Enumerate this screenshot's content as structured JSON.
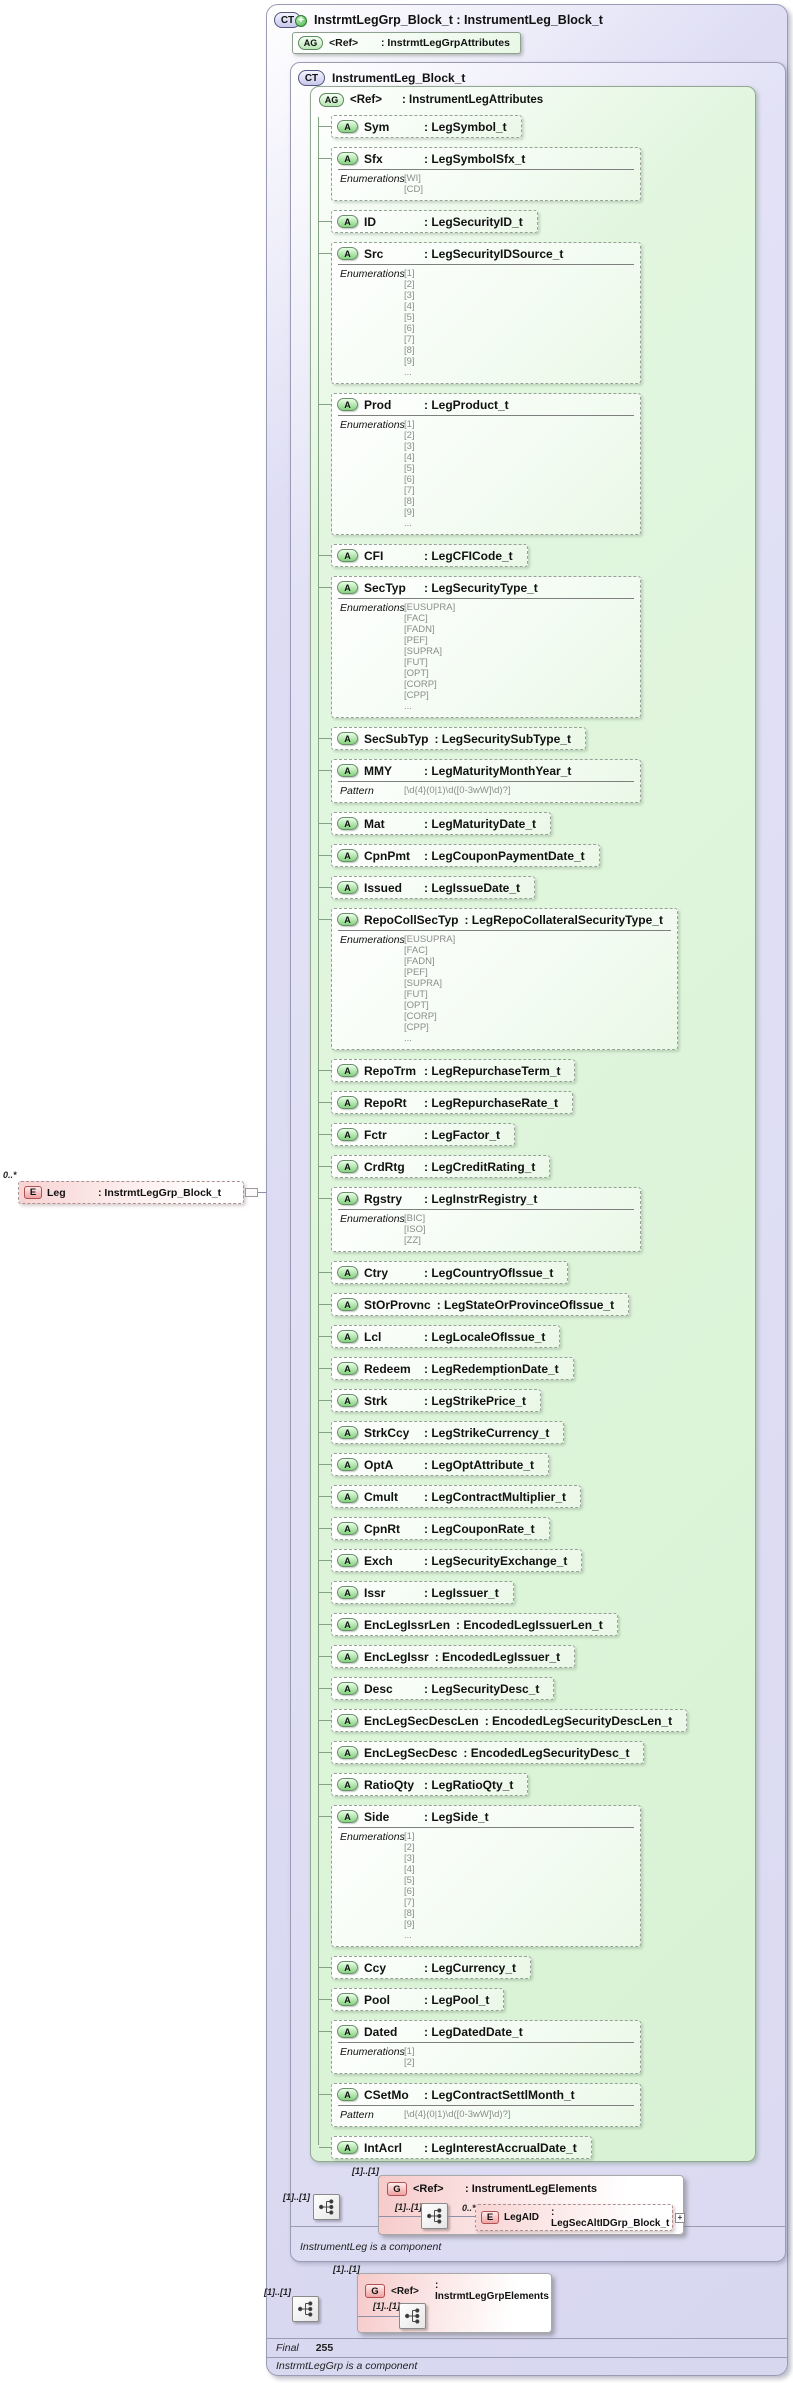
{
  "diagram": {
    "outer": {
      "badge": "CT",
      "badge_plus": "+",
      "title": "InstrmtLegGrp_Block_t : InstrumentLeg_Block_t",
      "final_label": "Final",
      "final_value": "255",
      "footnote": "InstrmtLegGrp is a component",
      "attr_ref": {
        "badge": "AG",
        "name": "<Ref>",
        "type": ": InstrmtLegGrpAttributes"
      },
      "elements_ref": {
        "badge": "G",
        "name": "<Ref>",
        "type": ": InstrmtLegGrpElements",
        "outer_cardinality": "[1]..[1]",
        "ref_cardinality": "[1]..[1]",
        "inner_cardinality": "[1]..[1]"
      }
    },
    "leg_element": {
      "cardinality": "0..*",
      "badge": "E",
      "name": "Leg",
      "type": ": InstrmtLegGrp_Block_t"
    },
    "inner": {
      "badge": "CT",
      "title": "InstrumentLeg_Block_t",
      "footnote": "InstrumentLeg is a component",
      "attr_group": {
        "badge": "AG",
        "name": "<Ref>",
        "type": ": InstrumentLegAttributes",
        "attr_badge": "A"
      },
      "attributes": [
        {
          "name": "Sym",
          "type": ": LegSymbol_t"
        },
        {
          "name": "Sfx",
          "type": ": LegSymbolSfx_t",
          "facet_label": "Enumerations",
          "facet_values": [
            "[WI]",
            "[CD]"
          ]
        },
        {
          "name": "ID",
          "type": ": LegSecurityID_t"
        },
        {
          "name": "Src",
          "type": ": LegSecurityIDSource_t",
          "facet_label": "Enumerations",
          "facet_values": [
            "[1]",
            "[2]",
            "[3]",
            "[4]",
            "[5]",
            "[6]",
            "[7]",
            "[8]",
            "[9]",
            "..."
          ]
        },
        {
          "name": "Prod",
          "type": ": LegProduct_t",
          "facet_label": "Enumerations",
          "facet_values": [
            "[1]",
            "[2]",
            "[3]",
            "[4]",
            "[5]",
            "[6]",
            "[7]",
            "[8]",
            "[9]",
            "..."
          ]
        },
        {
          "name": "CFI",
          "type": ": LegCFICode_t"
        },
        {
          "name": "SecTyp",
          "type": ": LegSecurityType_t",
          "facet_label": "Enumerations",
          "facet_values": [
            "[EUSUPRA]",
            "[FAC]",
            "[FADN]",
            "[PEF]",
            "[SUPRA]",
            "[FUT]",
            "[OPT]",
            "[CORP]",
            "[CPP]",
            "..."
          ]
        },
        {
          "name": "SecSubTyp",
          "type": ": LegSecuritySubType_t"
        },
        {
          "name": "MMY",
          "type": ": LegMaturityMonthYear_t",
          "facet_label": "Pattern",
          "facet_values": [
            "[\\d{4}(0|1)\\d([0-3wW]\\d)?]"
          ]
        },
        {
          "name": "Mat",
          "type": ": LegMaturityDate_t"
        },
        {
          "name": "CpnPmt",
          "type": ": LegCouponPaymentDate_t"
        },
        {
          "name": "Issued",
          "type": ": LegIssueDate_t"
        },
        {
          "name": "RepoCollSecTyp",
          "type": ": LegRepoCollateralSecurityType_t",
          "facet_label": "Enumerations",
          "facet_values": [
            "[EUSUPRA]",
            "[FAC]",
            "[FADN]",
            "[PEF]",
            "[SUPRA]",
            "[FUT]",
            "[OPT]",
            "[CORP]",
            "[CPP]",
            "..."
          ]
        },
        {
          "name": "RepoTrm",
          "type": ": LegRepurchaseTerm_t"
        },
        {
          "name": "RepoRt",
          "type": ": LegRepurchaseRate_t"
        },
        {
          "name": "Fctr",
          "type": ": LegFactor_t"
        },
        {
          "name": "CrdRtg",
          "type": ": LegCreditRating_t"
        },
        {
          "name": "Rgstry",
          "type": ": LegInstrRegistry_t",
          "facet_label": "Enumerations",
          "facet_values": [
            "[BIC]",
            "[ISO]",
            "[ZZ]"
          ]
        },
        {
          "name": "Ctry",
          "type": ": LegCountryOfIssue_t"
        },
        {
          "name": "StOrProvnc",
          "type": ": LegStateOrProvinceOfIssue_t"
        },
        {
          "name": "Lcl",
          "type": ": LegLocaleOfIssue_t"
        },
        {
          "name": "Redeem",
          "type": ": LegRedemptionDate_t"
        },
        {
          "name": "Strk",
          "type": ": LegStrikePrice_t"
        },
        {
          "name": "StrkCcy",
          "type": ": LegStrikeCurrency_t"
        },
        {
          "name": "OptA",
          "type": ": LegOptAttribute_t"
        },
        {
          "name": "Cmult",
          "type": ": LegContractMultiplier_t"
        },
        {
          "name": "CpnRt",
          "type": ": LegCouponRate_t"
        },
        {
          "name": "Exch",
          "type": ": LegSecurityExchange_t"
        },
        {
          "name": "Issr",
          "type": ": LegIssuer_t"
        },
        {
          "name": "EncLegIssrLen",
          "type": ": EncodedLegIssuerLen_t"
        },
        {
          "name": "EncLegIssr",
          "type": ": EncodedLegIssuer_t"
        },
        {
          "name": "Desc",
          "type": ": LegSecurityDesc_t"
        },
        {
          "name": "EncLegSecDescLen",
          "type": ": EncodedLegSecurityDescLen_t"
        },
        {
          "name": "EncLegSecDesc",
          "type": ": EncodedLegSecurityDesc_t"
        },
        {
          "name": "RatioQty",
          "type": ": LegRatioQty_t"
        },
        {
          "name": "Side",
          "type": ": LegSide_t",
          "facet_label": "Enumerations",
          "facet_values": [
            "[1]",
            "[2]",
            "[3]",
            "[4]",
            "[5]",
            "[6]",
            "[7]",
            "[8]",
            "[9]",
            "..."
          ]
        },
        {
          "name": "Ccy",
          "type": ": LegCurrency_t"
        },
        {
          "name": "Pool",
          "type": ": LegPool_t"
        },
        {
          "name": "Dated",
          "type": ": LegDatedDate_t",
          "facet_label": "Enumerations",
          "facet_values": [
            "[1]",
            "[2]"
          ]
        },
        {
          "name": "CSetMo",
          "type": ": LegContractSettlMonth_t",
          "facet_label": "Pattern",
          "facet_values": [
            "[\\d{4}(0|1)\\d([0-3wW]\\d)?]"
          ]
        },
        {
          "name": "IntAcrl",
          "type": ": LegInterestAccrualDate_t"
        }
      ],
      "elements_ref": {
        "badge": "G",
        "name": "<Ref>",
        "type": ": InstrumentLegElements",
        "outer_cardinality": "[1]..[1]",
        "ref_cardinality": "[1]..[1]",
        "inner_cardinality": "[1]..[1]",
        "child": {
          "cardinality": "0..*",
          "badge": "E",
          "name": "LegAID",
          "type": ": LegSecAltIDGrp_Block_t",
          "expander": "+"
        }
      }
    }
  }
}
